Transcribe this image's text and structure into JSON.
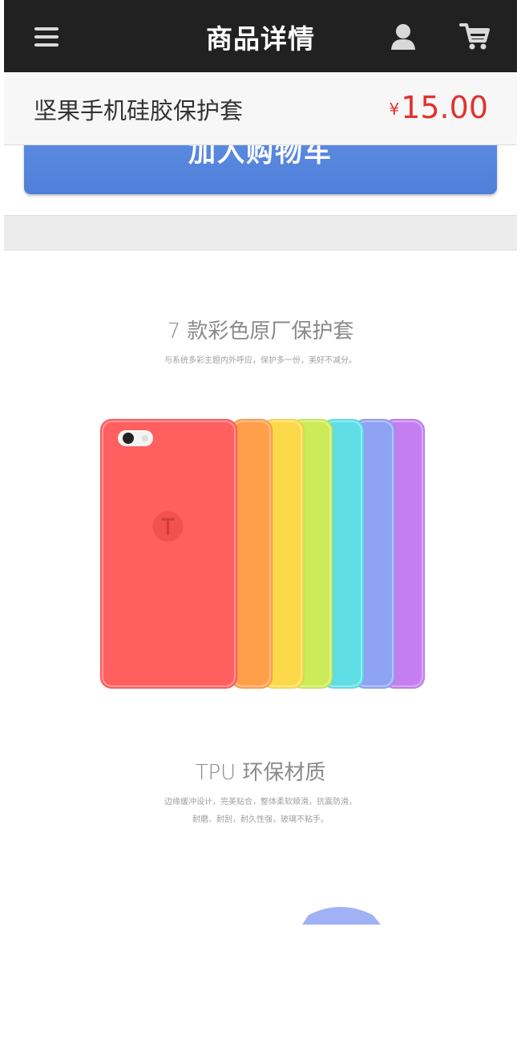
{
  "navbar": {
    "title": "商品详情",
    "menu_icon": "menu-icon",
    "user_icon": "user-icon",
    "cart_icon": "shopping-cart-icon"
  },
  "product": {
    "name": "坚果手机硅胶保护套",
    "currency": "¥",
    "price": "15.00",
    "price_color": "#e0332f"
  },
  "actions": {
    "add_to_cart_label": "加入购物车",
    "button_color": "#5a89e0"
  },
  "detail": {
    "section1": {
      "headline": "7 款彩色原厂保护套",
      "subline": "与系统多彩主题内外呼应，保护多一份，美好不减分。"
    },
    "case_colors": [
      "#ff5f5f",
      "#ff9f4a",
      "#fcd94a",
      "#cdea57",
      "#5fdfe5",
      "#8fa3f5",
      "#c47ef0"
    ],
    "section2": {
      "headline": "TPU 环保材质",
      "subline_1": "边缘缓冲设计，完美贴合，整体柔软顺滑，抗震防滑，",
      "subline_2": "耐磨、耐刮，耐久性强，玻璃不粘手。"
    }
  }
}
